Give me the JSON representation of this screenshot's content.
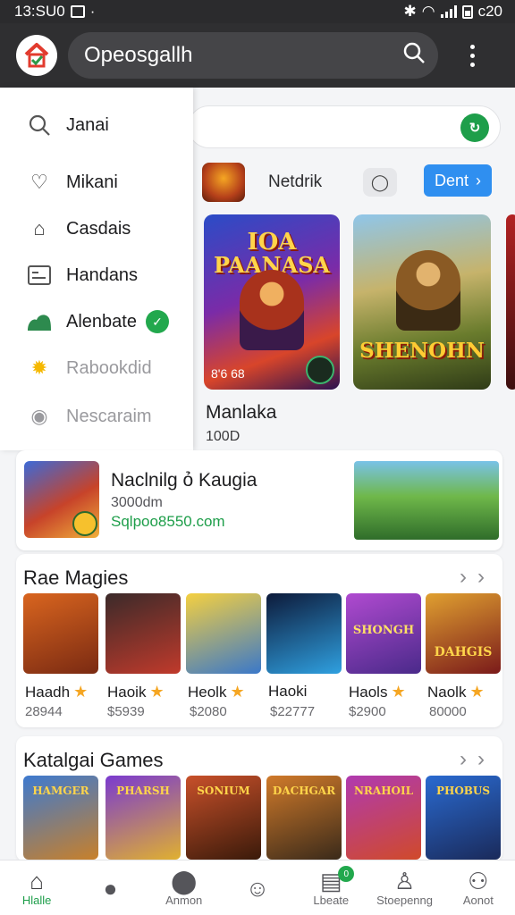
{
  "status_bar": {
    "time": "13:SU0",
    "right_text": "c20"
  },
  "app_bar": {
    "title": "Opeosgallh",
    "logo_colors": {
      "roof": "#e23b2e",
      "door": "#2d9a48"
    }
  },
  "search": {
    "placeholder": ""
  },
  "drawer": {
    "items": [
      {
        "label": "Janai",
        "icon": "search-icon",
        "faded": false
      },
      {
        "label": "Mikani",
        "icon": "heart-outline-icon",
        "faded": false
      },
      {
        "label": "Casdais",
        "icon": "tag-icon",
        "faded": false
      },
      {
        "label": "Handans",
        "icon": "id-card-icon",
        "faded": false
      },
      {
        "label": "Alenbate",
        "icon": "people-icon",
        "faded": false,
        "badge": "✓"
      },
      {
        "label": "Rabookdid",
        "icon": "sun-badge-icon",
        "faded": true
      },
      {
        "label": "Nescaraim",
        "icon": "chat-bubble-icon",
        "faded": true
      }
    ]
  },
  "developer": {
    "name": "Netdrik",
    "button_label": "Dent"
  },
  "featured": [
    {
      "art_title_line1": "IOA",
      "art_title_line2": "PAANASA",
      "rating": "8'6 68"
    },
    {
      "art_title": "SHENOHN"
    }
  ],
  "featured_caption": {
    "name": "Manlaka",
    "size": "100D"
  },
  "promo": {
    "title": "Naclnilg ỏ Kaugia",
    "subtitle": "3000dm",
    "url": "Sqlpoo8550.com"
  },
  "sections": [
    {
      "title": "Rae Magies",
      "tiles": [
        {
          "name": "Haadh",
          "price": "28944",
          "colors": [
            "#d9651f",
            "#7a2a12"
          ]
        },
        {
          "name": "Haoik",
          "price": "$5939",
          "colors": [
            "#3b2a2a",
            "#c03a2b"
          ]
        },
        {
          "name": "Heolk",
          "price": "$2080",
          "colors": [
            "#f5d040",
            "#3a78c9"
          ]
        },
        {
          "name": "Haoki",
          "price": "$22777",
          "colors": [
            "#0d1a3a",
            "#2fa0e0"
          ]
        },
        {
          "name": "Haols",
          "price": "$2900",
          "colors": [
            "#b04ad0",
            "#4a2a8a"
          ]
        },
        {
          "name": "Naolk",
          "price": "80000",
          "colors": [
            "#e0a030",
            "#7a1a1a"
          ]
        }
      ],
      "tile_art": [
        "",
        "",
        "",
        "",
        "SHONGH",
        "DAHGIS"
      ]
    },
    {
      "title": "Katalgai Games",
      "tiles": [
        {
          "colors": [
            "#3d7ad0",
            "#c8802a"
          ],
          "art": "HAMGER"
        },
        {
          "colors": [
            "#7a3ad0",
            "#e0b030"
          ],
          "art": "PHARSH"
        },
        {
          "colors": [
            "#c8502a",
            "#3a1a0a"
          ],
          "art": "SONIUM"
        },
        {
          "colors": [
            "#d07a2a",
            "#3a2a1a"
          ],
          "art": "DACHGAR"
        },
        {
          "colors": [
            "#b03ab0",
            "#d04a2a"
          ],
          "art": "NRAHOIL"
        },
        {
          "colors": [
            "#2a6ad0",
            "#1a2a5a"
          ],
          "art": "PHOBUS"
        }
      ]
    }
  ],
  "bottom_nav": [
    {
      "label": "Hlalle",
      "icon": "home-icon",
      "active": true
    },
    {
      "label": "",
      "icon": "person-icon",
      "active": false
    },
    {
      "label": "Anmon",
      "icon": "location-pin-icon",
      "active": false
    },
    {
      "label": "",
      "icon": "emoji-icon",
      "active": false
    },
    {
      "label": "Lbeate",
      "icon": "inbox-icon",
      "active": false,
      "badge": "0"
    },
    {
      "label": "Stoepenng",
      "icon": "profile-search-icon",
      "active": false
    },
    {
      "label": "Aonot",
      "icon": "group-icon",
      "active": false
    }
  ]
}
